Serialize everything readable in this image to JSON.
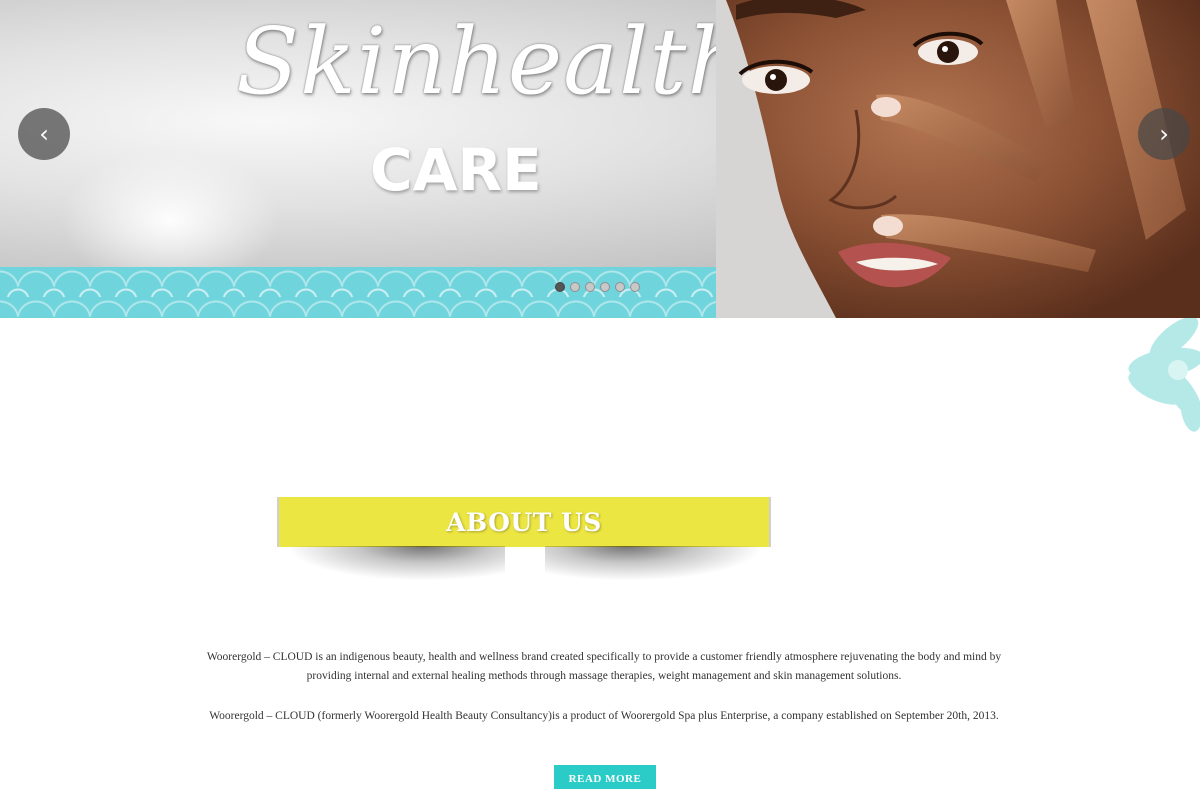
{
  "hero": {
    "title_script": "Skinhealth",
    "title_bold": "CARE",
    "prev_icon": "chevron-left-icon",
    "next_icon": "chevron-right-icon",
    "prev_glyph": "‹",
    "next_glyph": "›",
    "slide_count": 6,
    "active_slide": 1
  },
  "about": {
    "heading": "ABOUT US",
    "paragraph1": "Woorergold – CLOUD is an indigenous beauty, health and wellness brand created specifically to provide a customer friendly atmosphere rejuvenating the body and mind by providing internal and external healing methods through massage therapies, weight management and skin management solutions.",
    "paragraph2": "Woorergold – CLOUD (formerly Woorergold Health Beauty Consultancy)is a product of Woorergold Spa plus Enterprise, a company established on September 20th, 2013.",
    "read_more_label": "READ MORE"
  },
  "colors": {
    "banner_yellow": "#ece642",
    "accent_teal": "#2bccc8",
    "pattern_teal": "#6fd4dc"
  }
}
